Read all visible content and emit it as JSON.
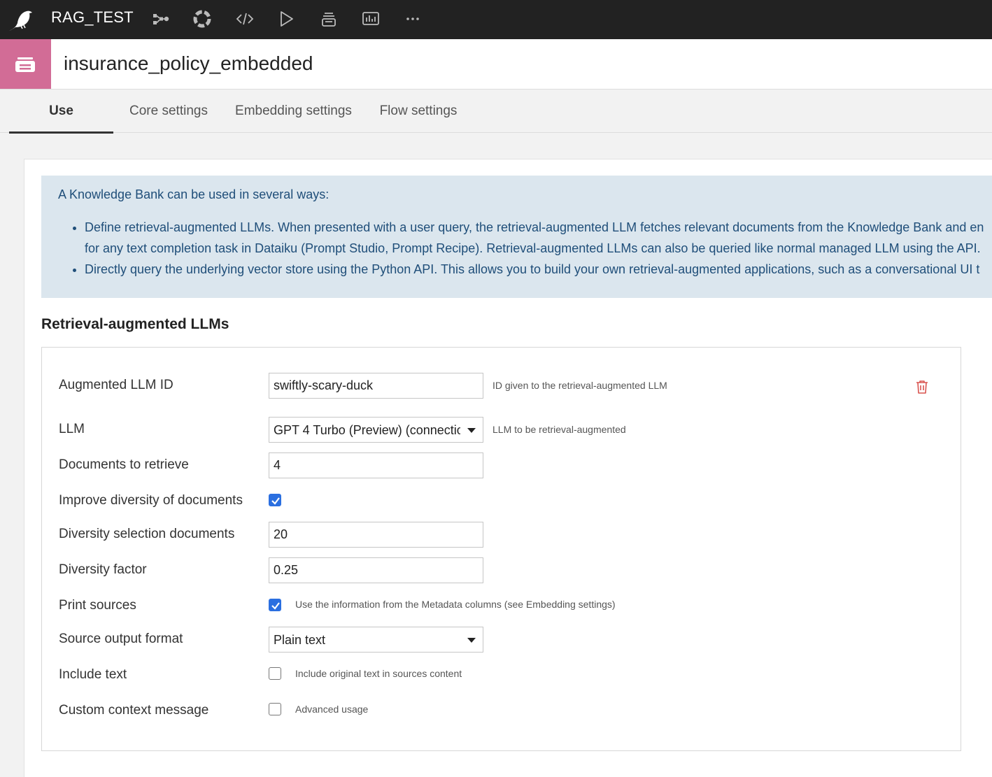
{
  "topbar": {
    "project_name": "RAG_TEST",
    "nav_icons": [
      "flow-icon",
      "lab-icon",
      "code-icon",
      "run-icon",
      "datasets-stack-icon",
      "dashboard-icon",
      "more-icon"
    ]
  },
  "object": {
    "icon": "knowledge-bank-icon",
    "badge_color": "#d26c96",
    "title": "insurance_policy_embedded"
  },
  "tabs": [
    {
      "label": "Use",
      "active": true
    },
    {
      "label": "Core settings",
      "active": false
    },
    {
      "label": "Embedding settings",
      "active": false
    },
    {
      "label": "Flow settings",
      "active": false
    }
  ],
  "info": {
    "intro": "A Knowledge Bank can be used in several ways:",
    "bullet1_line1": "Define retrieval-augmented LLMs. When presented with a user query, the retrieval-augmented LLM fetches relevant documents from the Knowledge Bank and en",
    "bullet1_line2": "for any text completion task in Dataiku (Prompt Studio, Prompt Recipe). Retrieval-augmented LLMs can also be queried like normal managed LLM using the API.",
    "bullet2": "Directly query the underlying vector store using the Python API. This allows you to build your own retrieval-augmented applications, such as a conversational UI t"
  },
  "section_title": "Retrieval-augmented LLMs",
  "form": {
    "augmented_llm_id": {
      "label": "Augmented LLM ID",
      "value": "swiftly-scary-duck",
      "hint": "ID given to the retrieval-augmented LLM"
    },
    "llm": {
      "label": "LLM",
      "value": "GPT 4 Turbo (Preview) (connectio",
      "hint": "LLM to be retrieval-augmented"
    },
    "documents_to_retrieve": {
      "label": "Documents to retrieve",
      "value": "4"
    },
    "improve_diversity": {
      "label": "Improve diversity of documents",
      "checked": true
    },
    "diversity_selection_documents": {
      "label": "Diversity selection documents",
      "value": "20"
    },
    "diversity_factor": {
      "label": "Diversity factor",
      "value": "0.25"
    },
    "print_sources": {
      "label": "Print sources",
      "checked": true,
      "hint": "Use the information from the Metadata columns (see Embedding settings)"
    },
    "source_output_format": {
      "label": "Source output format",
      "value": "Plain text"
    },
    "include_text": {
      "label": "Include text",
      "checked": false,
      "hint": "Include original text in sources content"
    },
    "custom_context_message": {
      "label": "Custom context message",
      "checked": false,
      "hint": "Advanced usage"
    }
  },
  "colors": {
    "topbar": "#222222",
    "info_bg": "#dbe6ee",
    "info_text": "#1f4e79",
    "checkbox_accent": "#2b6fe0",
    "delete_icon": "#d9534f"
  }
}
